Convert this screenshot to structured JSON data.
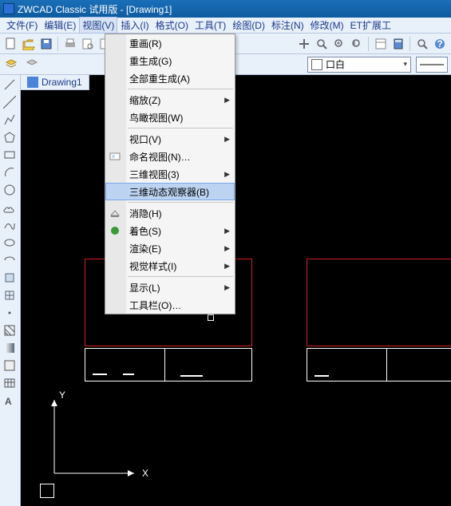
{
  "title": "ZWCAD Classic 试用版 - [Drawing1]",
  "menu": {
    "items": [
      "文件(F)",
      "编辑(E)",
      "视图(V)",
      "插入(I)",
      "格式(O)",
      "工具(T)",
      "绘图(D)",
      "标注(N)",
      "修改(M)",
      "ET扩展工"
    ],
    "active_index": 2
  },
  "toolbar_icons": {
    "new": "new-icon",
    "open": "open-icon",
    "save": "save-icon",
    "print": "print-icon",
    "undo": "undo-icon",
    "redo": "redo-icon",
    "cut": "cut-icon",
    "copy": "copy-icon",
    "paste": "paste-icon",
    "pan": "pan-icon",
    "zoom": "zoom-icon",
    "calc": "calc-icon",
    "help": "help-icon"
  },
  "layer_dropdown": {
    "color": "#ffffff",
    "label": "口白"
  },
  "doc_tab": {
    "label": "Drawing1"
  },
  "view_menu": {
    "items": [
      {
        "label": "重画(R)",
        "sep": false,
        "sub": false,
        "icon": null
      },
      {
        "label": "重生成(G)",
        "sep": false,
        "sub": false,
        "icon": null
      },
      {
        "label": "全部重生成(A)",
        "sep": true,
        "sub": false,
        "icon": null
      },
      {
        "label": "缩放(Z)",
        "sep": false,
        "sub": true,
        "icon": null
      },
      {
        "label": "鸟瞰视图(W)",
        "sep": true,
        "sub": false,
        "icon": null
      },
      {
        "label": "视口(V)",
        "sep": false,
        "sub": true,
        "icon": null
      },
      {
        "label": "命名视图(N)…",
        "sep": false,
        "sub": false,
        "icon": "named-views-icon"
      },
      {
        "label": "三维视图(3)",
        "sep": false,
        "sub": true,
        "icon": null
      },
      {
        "label": "三维动态观察器(B)",
        "sep": true,
        "sub": false,
        "icon": null,
        "highlight": true
      },
      {
        "label": "消隐(H)",
        "sep": false,
        "sub": false,
        "icon": "hide-icon"
      },
      {
        "label": "着色(S)",
        "sep": false,
        "sub": true,
        "icon": "shade-icon"
      },
      {
        "label": "渲染(E)",
        "sep": false,
        "sub": true,
        "icon": null
      },
      {
        "label": "视觉样式(I)",
        "sep": true,
        "sub": true,
        "icon": null
      },
      {
        "label": "显示(L)",
        "sep": false,
        "sub": true,
        "icon": null
      },
      {
        "label": "工具栏(O)…",
        "sep": false,
        "sub": false,
        "icon": null
      }
    ]
  },
  "axis": {
    "x": "X",
    "y": "Y"
  }
}
